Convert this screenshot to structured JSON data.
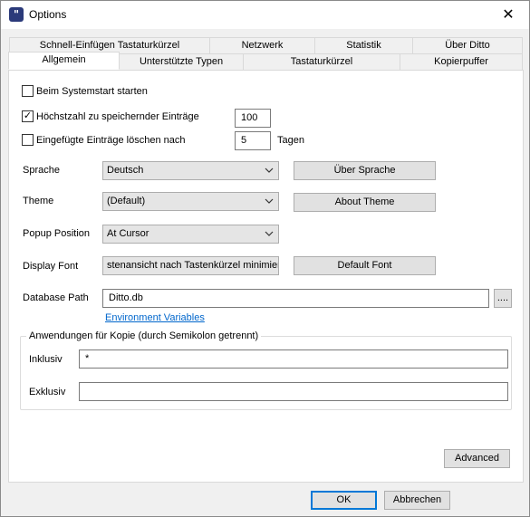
{
  "window": {
    "title": "Options",
    "icon": "ditto-app-icon"
  },
  "tabs": {
    "back_row": [
      "Schnell-Einfügen Tastaturkürzel",
      "Netzwerk",
      "Statistik",
      "Über Ditto"
    ],
    "front_row": [
      "Allgemein",
      "Unterstützte Typen",
      "Tastaturkürzel",
      "Kopierpuffer"
    ],
    "active": "Allgemein"
  },
  "general": {
    "start_on_startup": {
      "label": "Beim Systemstart starten",
      "checked": false
    },
    "max_entries": {
      "label": "Höchstzahl zu speichernder Einträge",
      "checked": true,
      "value": "100"
    },
    "delete_after": {
      "label": "Eingefügte Einträge löschen nach",
      "checked": false,
      "value": "5",
      "unit": "Tagen"
    }
  },
  "language": {
    "label": "Sprache",
    "value": "Deutsch",
    "button": "Über Sprache"
  },
  "theme": {
    "label": "Theme",
    "value": "(Default)",
    "button": "About Theme"
  },
  "popup": {
    "label": "Popup Position",
    "value": "At Cursor"
  },
  "display_font": {
    "label": "Display Font",
    "value": "stenansicht nach Tastenkürzel minimiere",
    "button": "Default Font"
  },
  "database": {
    "label": "Database Path",
    "value": "Ditto.db",
    "browse": "....",
    "link": "Environment Variables"
  },
  "apps_group": {
    "legend": "Anwendungen für Kopie (durch Semikolon getrennt)",
    "include": {
      "label": "Inklusiv",
      "value": "*"
    },
    "exclude": {
      "label": "Exklusiv",
      "value": ""
    }
  },
  "buttons": {
    "advanced": "Advanced",
    "ok": "OK",
    "cancel": "Abbrechen"
  },
  "colors": {
    "accent": "#0078d7",
    "link": "#0066cc",
    "app_icon": "#2b3a7a"
  }
}
